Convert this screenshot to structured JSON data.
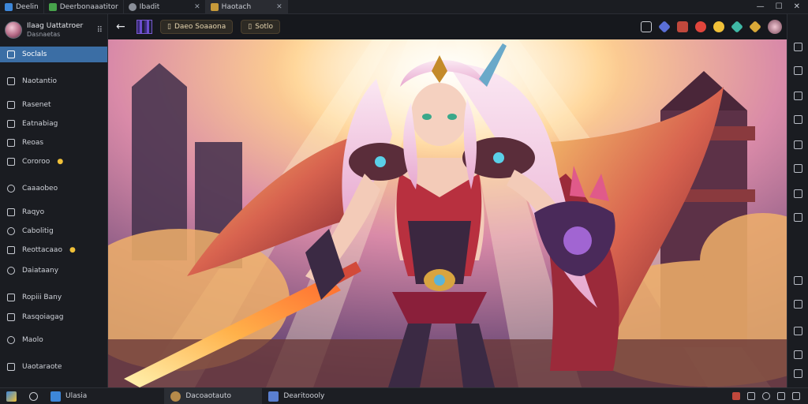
{
  "window": {
    "tabs": [
      {
        "label": "Deelin",
        "color": "#3d87d9"
      },
      {
        "label": "Deerbonaaatitor",
        "color": "#47a34b"
      },
      {
        "label": "Ibadit",
        "color": "#8a8f99"
      },
      {
        "label": "Haotach",
        "color": "#c79a3a"
      }
    ],
    "controls": {
      "minimize": "—",
      "maximize": "☐",
      "close": "✕"
    }
  },
  "profile": {
    "name": "Ilaag Uattatroer",
    "subtitle": "Dasnaetas"
  },
  "sidebar": {
    "items": [
      {
        "label": "Soclals",
        "icon": "home-icon",
        "active": true,
        "badge": ""
      },
      {
        "label": "Naotantio",
        "icon": "bell-icon",
        "active": false,
        "badge": ""
      },
      {
        "label": "Rasenet",
        "icon": "folder-icon",
        "active": false,
        "badge": ""
      },
      {
        "label": "Eatnabiag",
        "icon": "list-icon",
        "active": false,
        "badge": ""
      },
      {
        "label": "Reoas",
        "icon": "image-icon",
        "active": false,
        "badge": ""
      },
      {
        "label": "Cororoo",
        "icon": "chat-icon",
        "active": false,
        "badge": "●"
      },
      {
        "label": "Caaaobeo",
        "icon": "shield-icon",
        "active": false,
        "badge": ""
      },
      {
        "label": "Raqyo",
        "icon": "flag-icon",
        "active": false,
        "badge": ""
      },
      {
        "label": "Cabolitig",
        "icon": "clock-icon",
        "active": false,
        "badge": ""
      },
      {
        "label": "Reottacaao",
        "icon": "star-icon",
        "active": false,
        "badge": "●"
      },
      {
        "label": "Daiataany",
        "icon": "gear-icon",
        "active": false,
        "badge": ""
      },
      {
        "label": "Ropiii Bany",
        "icon": "document-icon",
        "active": false,
        "badge": ""
      },
      {
        "label": "Rasqoiagag",
        "icon": "tag-icon",
        "active": false,
        "badge": ""
      },
      {
        "label": "Maolo",
        "icon": "search-icon",
        "active": false,
        "badge": ""
      },
      {
        "label": "Uaotaraote",
        "icon": "user-icon",
        "active": false,
        "badge": ""
      }
    ]
  },
  "toolbar": {
    "back": "←",
    "chip1": "Daeo Soaaona",
    "chip2": "Sotlo",
    "chip_icon": "▯"
  },
  "taskbar": {
    "items": [
      {
        "label": "Ulasia",
        "color": "#3d87d9",
        "active": false
      },
      {
        "label": "Dacoaotauto",
        "color": "#b58a4a",
        "active": true
      },
      {
        "label": "Dearitoooly",
        "color": "#5a7fd0",
        "active": false
      }
    ]
  },
  "colors": {
    "accent": "#3b6ea5",
    "chip_text": "#e6d5b0",
    "badge": "#f0c038"
  }
}
